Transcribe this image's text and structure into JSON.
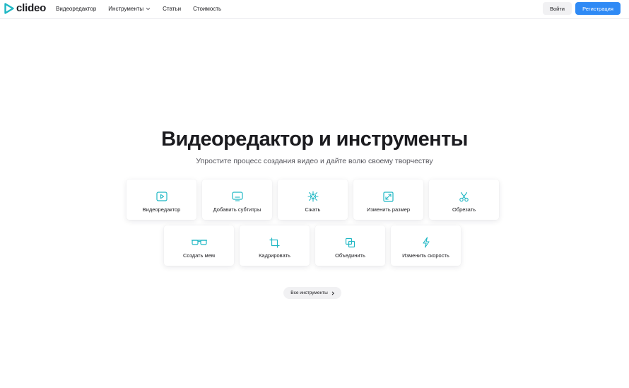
{
  "brand": {
    "name": "clideo",
    "accent": "#1fb7c4"
  },
  "nav": {
    "items": [
      {
        "label": "Видеоредактор"
      },
      {
        "label": "Инструменты",
        "has_dropdown": true
      },
      {
        "label": "Статьи"
      },
      {
        "label": "Стоимость"
      }
    ]
  },
  "auth": {
    "login_label": "Войти",
    "signup_label": "Регистрация",
    "signup_color": "#2f8af5"
  },
  "hero": {
    "title": "Видеоредактор и инструменты",
    "subtitle": "Упростите процесс создания видео и дайте волю своему творчеству"
  },
  "tools": [
    {
      "label": "Видеоредактор",
      "icon": "play-icon"
    },
    {
      "label": "Добавить субтитры",
      "icon": "subtitles-icon"
    },
    {
      "label": "Сжать",
      "icon": "compress-icon"
    },
    {
      "label": "Изменить размер",
      "icon": "resize-icon"
    },
    {
      "label": "Обрезать",
      "icon": "scissors-icon"
    },
    {
      "label": "Создать мем",
      "icon": "glasses-icon"
    },
    {
      "label": "Кадрировать",
      "icon": "crop-icon"
    },
    {
      "label": "Объединить",
      "icon": "merge-icon"
    },
    {
      "label": "Изменить скорость",
      "icon": "lightning-icon"
    }
  ],
  "all_tools_label": "Все инструменты"
}
